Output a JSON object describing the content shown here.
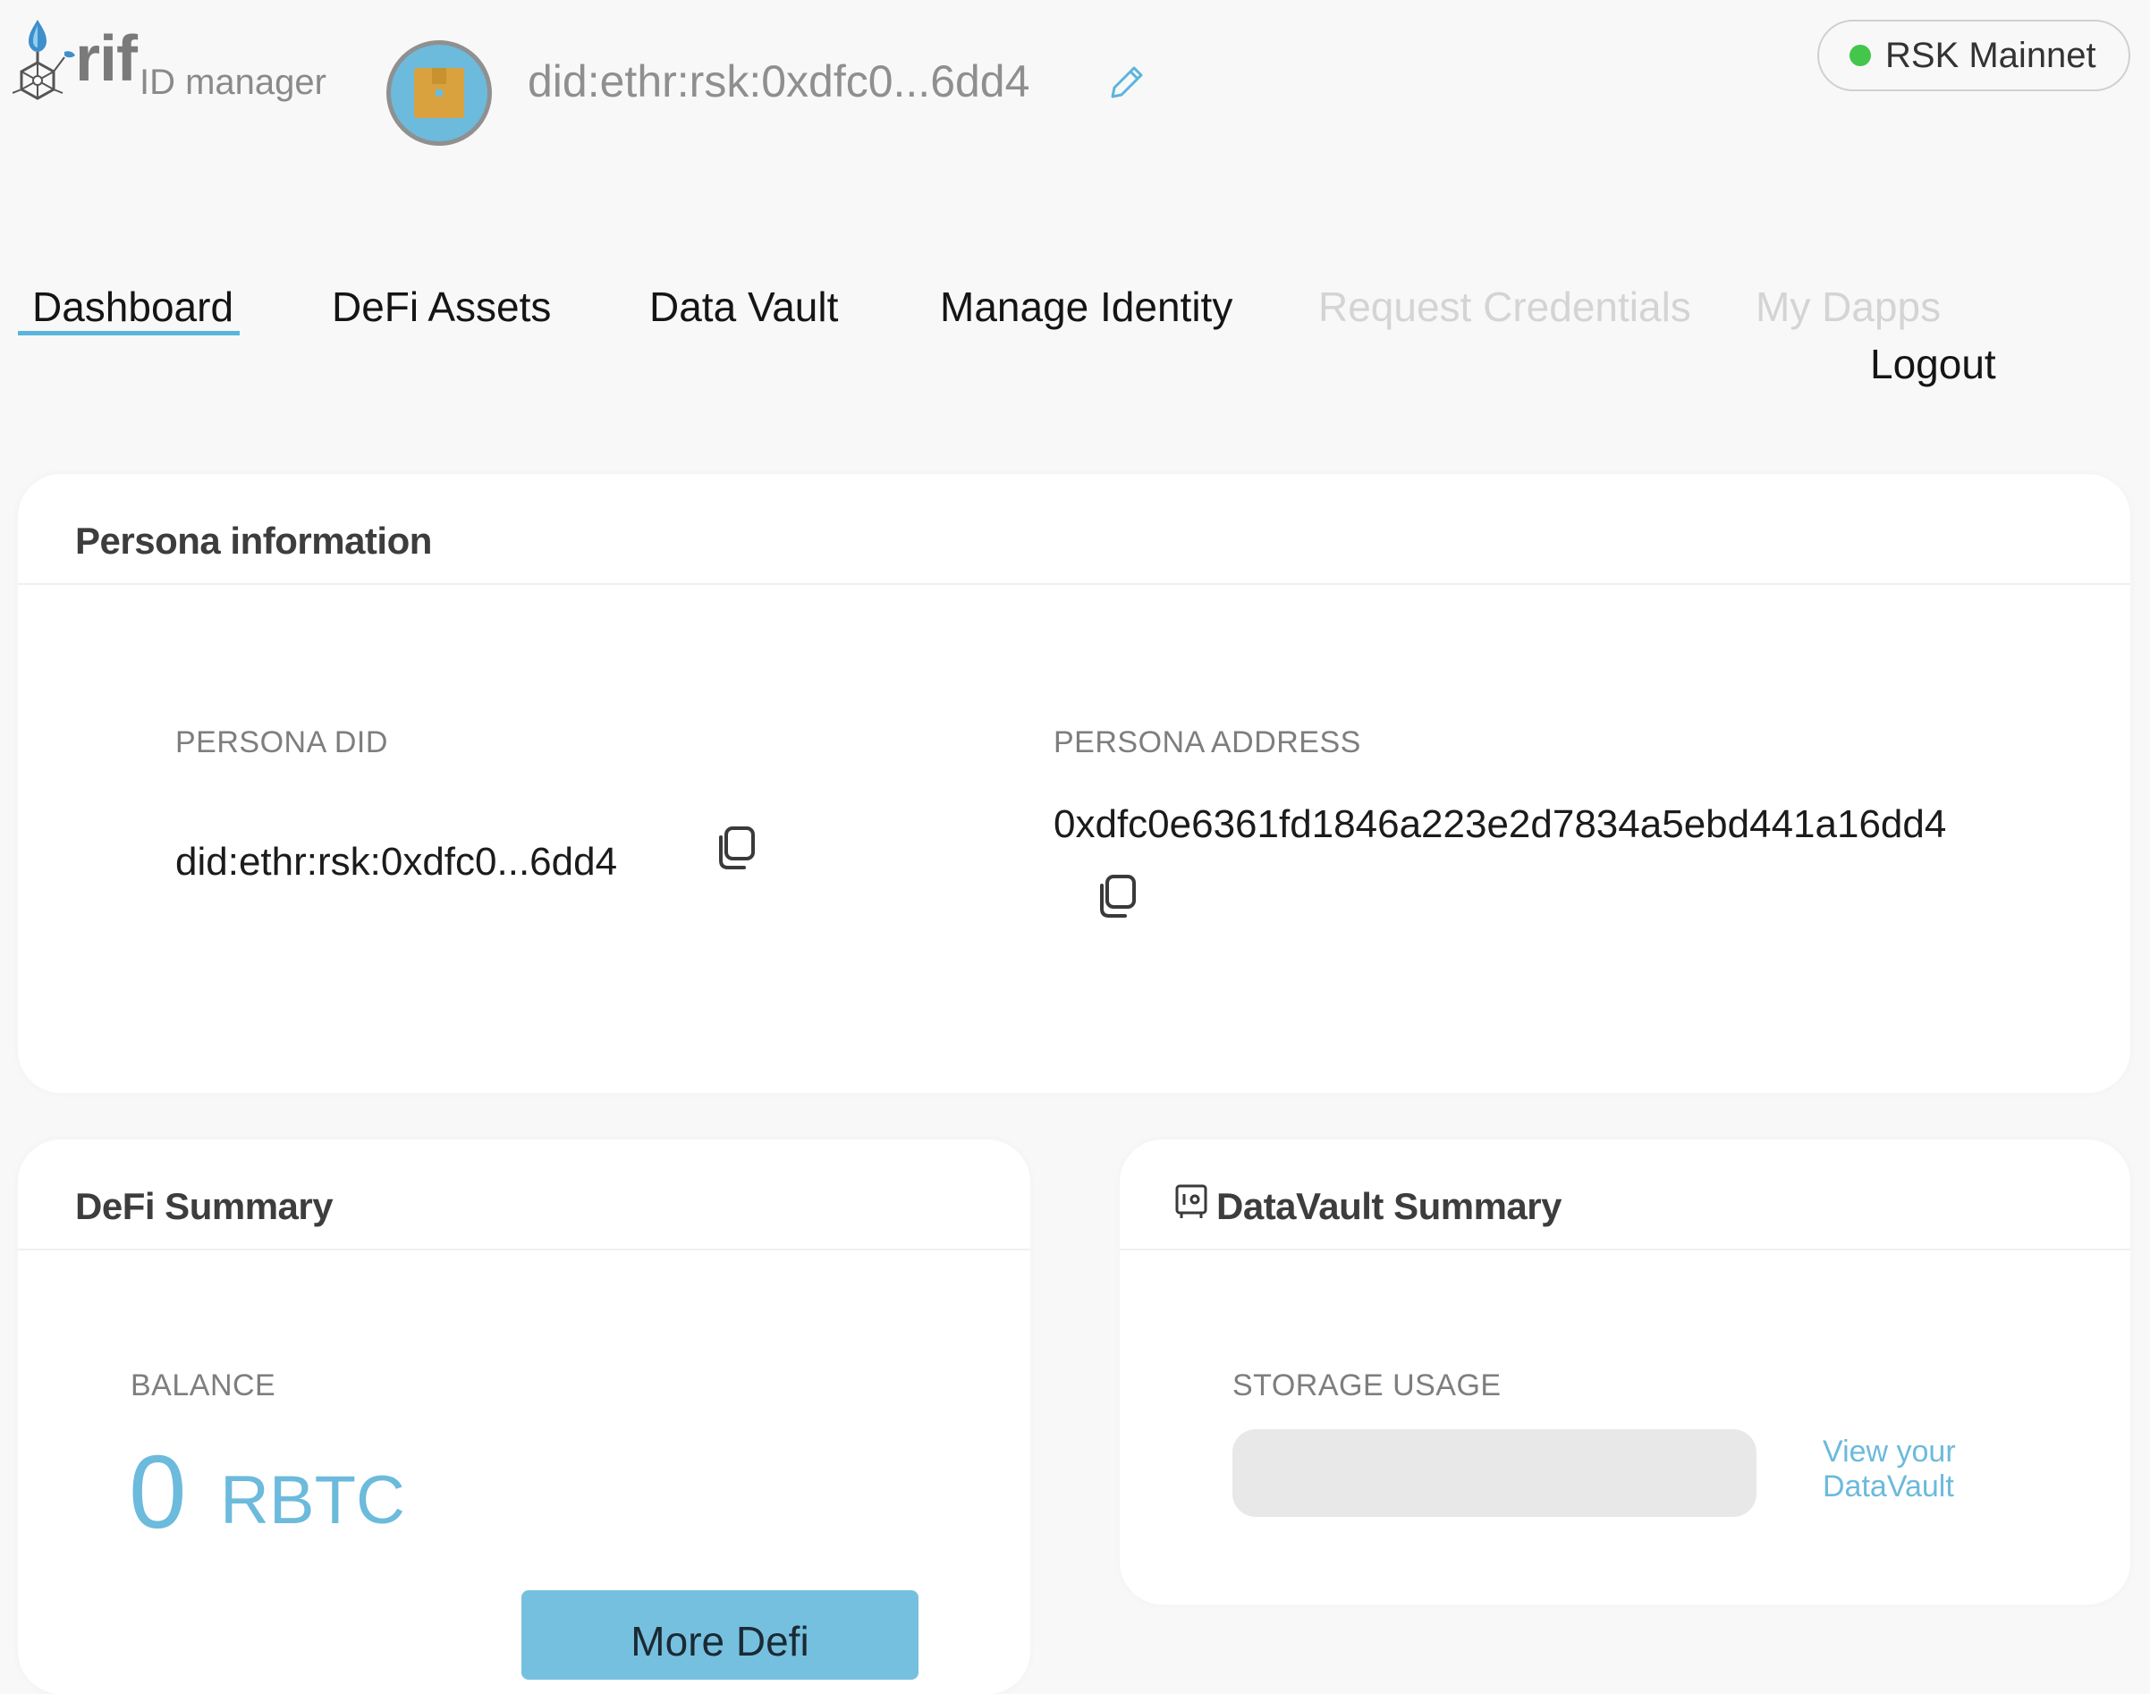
{
  "header": {
    "logo_brand": "rif",
    "logo_product": "ID manager",
    "did_short": "did:ethr:rsk:0xdfc0...6dd4",
    "network": "RSK Mainnet",
    "network_status_color": "#43c64a",
    "avatar_icon": "box-icon",
    "edit_icon": "pencil-icon"
  },
  "nav": {
    "items": [
      {
        "label": "Dashboard",
        "active": true,
        "enabled": true
      },
      {
        "label": "DeFi Assets",
        "active": false,
        "enabled": true
      },
      {
        "label": "Data Vault",
        "active": false,
        "enabled": true
      },
      {
        "label": "Manage Identity",
        "active": false,
        "enabled": true
      },
      {
        "label": "Request Credentials",
        "active": false,
        "enabled": false
      },
      {
        "label": "My Dapps",
        "active": false,
        "enabled": false
      }
    ],
    "logout": "Logout"
  },
  "persona": {
    "title": "Persona information",
    "did_label": "PERSONA DID",
    "did_value": "did:ethr:rsk:0xdfc0...6dd4",
    "address_label": "PERSONA ADDRESS",
    "address_value": "0xdfc0e6361fd1846a223e2d7834a5ebd441a16dd4",
    "copy_icon": "copy-icon"
  },
  "defi": {
    "title": "DeFi Summary",
    "balance_label": "BALANCE",
    "balance_value": "0",
    "balance_unit": "RBTC",
    "more_button": "More Defi"
  },
  "datavault": {
    "title": "DataVault Summary",
    "title_icon": "vault-icon",
    "storage_label": "STORAGE USAGE",
    "storage_used_fraction": 0,
    "view_link": "View your DataVault"
  },
  "colors": {
    "accent": "#6cbadc",
    "button": "#76c0df",
    "background": "#f8f8f8"
  }
}
